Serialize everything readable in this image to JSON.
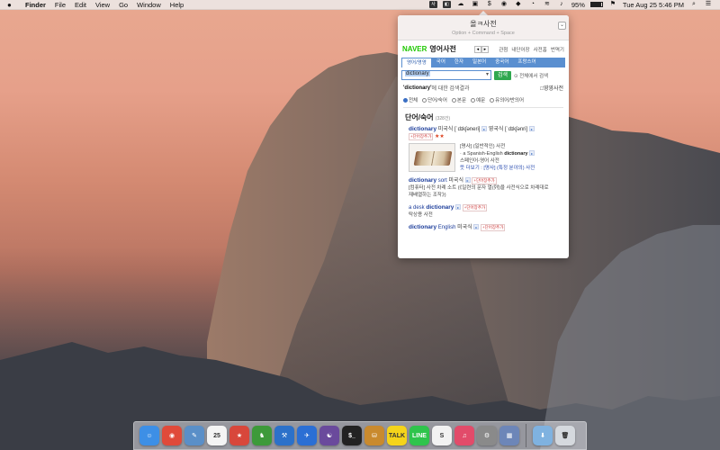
{
  "menubar": {
    "apple": "",
    "items": [
      "Finder",
      "File",
      "Edit",
      "View",
      "Go",
      "Window",
      "Help"
    ],
    "status": {
      "battery": "95%",
      "datetime": "Tue Aug 25  5:46 PM"
    }
  },
  "popup": {
    "title": "올ㅋ사전",
    "shortcut": "Option + Command + Space",
    "close": "⌄",
    "brand": "NAVER",
    "dict_name": "영어사전",
    "nav_prev": "◂",
    "nav_next": "▸",
    "links": [
      "관첨",
      "내단어장",
      "사전홈",
      "번역기"
    ],
    "tabs": [
      "영어/영영",
      "국어",
      "한자",
      "일본어",
      "중국어",
      "프랑스어"
    ],
    "search": {
      "value": "dictionary",
      "dropdown": "▾",
      "button": "검색",
      "option": "⊙ 전체에서 검색"
    },
    "result_head": {
      "query": "'dictionary'",
      "suffix": " 에 대한 검색결과",
      "right": "□영영사전"
    },
    "filters": [
      "전체",
      "단어/숙어",
      "본문",
      "예문",
      "유의어/반의어"
    ],
    "section": {
      "title": "단어/숙어",
      "count": "(328건)"
    },
    "entries": {
      "e1": {
        "word": "dictionary",
        "us": "미국식",
        "us_ipa": "[ˈdɪkʃəneri]",
        "uk": "영국식",
        "uk_ipa": "[ˈdɪkʃənri]",
        "tag": "+단어장추가",
        "stars": "★★"
      },
      "book": {
        "line1": "[명사] (일반적인) 사전",
        "line2_a": "a Spanish-English ",
        "line2_b": "dictionary",
        "line3": "스페인어-영어 사전",
        "line4": "뜻 더보기 : [명사] (특정 분야의) 사전"
      },
      "e2": {
        "word": "dictionary",
        "word2": " sort",
        "us": "미국식",
        "tag": "+단어장추가",
        "desc1": "[컴퓨터] 사전 차례 소트 (《일련의 문자 열(列)을 사전식으로 차례대로",
        "desc2": "재배열하는 조작》)"
      },
      "e3": {
        "word_a": "a desk ",
        "word_b": "dictionary",
        "tag": "+단어장추가",
        "desc": "탁상용 사전"
      },
      "e4": {
        "word": "dictionary",
        "word2": " English",
        "us": "미국식",
        "tag": "+단어장추가"
      }
    }
  },
  "dock": {
    "apps": [
      {
        "name": "finder-icon",
        "label": "☺",
        "color": "#3d8fe6"
      },
      {
        "name": "chrome-icon",
        "label": "◉",
        "color": "#e04a3a"
      },
      {
        "name": "preview-icon",
        "label": "✎",
        "color": "#5a8fc8"
      },
      {
        "name": "calendar-icon",
        "label": "25",
        "color": "#f4f4f4"
      },
      {
        "name": "wunderlist-icon",
        "label": "★",
        "color": "#d8473b"
      },
      {
        "name": "evernote-icon",
        "label": "♞",
        "color": "#3d9a3a"
      },
      {
        "name": "xcode-icon",
        "label": "⚒",
        "color": "#2c71c9"
      },
      {
        "name": "xcode-instruments-icon",
        "label": "✈",
        "color": "#2b6fd4"
      },
      {
        "name": "github-icon",
        "label": "☯",
        "color": "#6a4a9c"
      },
      {
        "name": "terminal-icon",
        "label": "$_",
        "color": "#222222"
      },
      {
        "name": "sequel-pro-icon",
        "label": "⛁",
        "color": "#c98a2e"
      },
      {
        "name": "kakaotalk-icon",
        "label": "TALK",
        "color": "#f5d41a"
      },
      {
        "name": "line-icon",
        "label": "LINE",
        "color": "#2fc44c"
      },
      {
        "name": "skype-icon",
        "label": "S",
        "color": "#f2f2f2"
      },
      {
        "name": "itunes-icon",
        "label": "♫",
        "color": "#e24b6a"
      },
      {
        "name": "system-preferences-icon",
        "label": "⚙",
        "color": "#8a8a8a"
      },
      {
        "name": "photos-icon",
        "label": "▦",
        "color": "#6d86b8"
      }
    ],
    "right": [
      {
        "name": "downloads-folder-icon",
        "label": "⬇",
        "color": "#7fb2e0"
      },
      {
        "name": "trash-icon",
        "label": "🗑",
        "color": "#d5d9de"
      }
    ]
  }
}
